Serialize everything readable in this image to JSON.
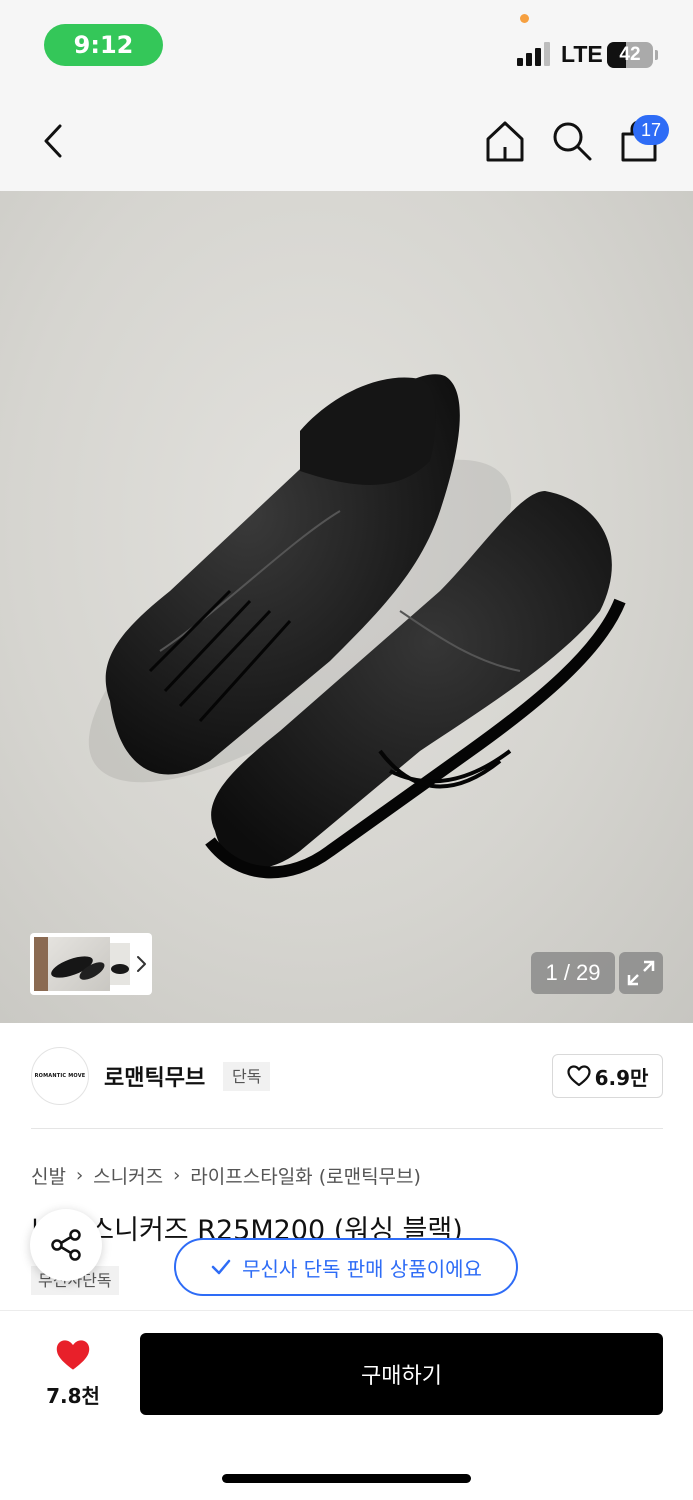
{
  "status_bar": {
    "time": "9:12",
    "network": "LTE",
    "battery_level": "42",
    "battery_fraction": 0.42
  },
  "nav": {
    "back_icon": "chevron-left-icon",
    "home_icon": "home-icon",
    "search_icon": "search-icon",
    "cart_icon": "shopping-bag-icon",
    "cart_count": "17"
  },
  "gallery": {
    "counter": "1 / 29",
    "expand_icon": "expand-icon"
  },
  "brand": {
    "logo_text": "ROMANTIC MOVE",
    "name": "로맨틱무브",
    "tag": "단독",
    "likes": "6.9만"
  },
  "breadcrumb": [
    "신발",
    "스니커즈",
    "라이프스타일화 (로맨틱무브)"
  ],
  "product": {
    "title": "니커 스니커즈 R25M200 (워싱 블랙)",
    "exclusive_tag": "무신사단독"
  },
  "toast": {
    "message": "무신사 단독 판매 상품이에요"
  },
  "bottom_bar": {
    "wish_count": "7.8천",
    "buy_label": "구매하기"
  },
  "colors": {
    "accent_blue": "#2e6cf6",
    "heart_red": "#e8202a",
    "time_green": "#34c759"
  }
}
